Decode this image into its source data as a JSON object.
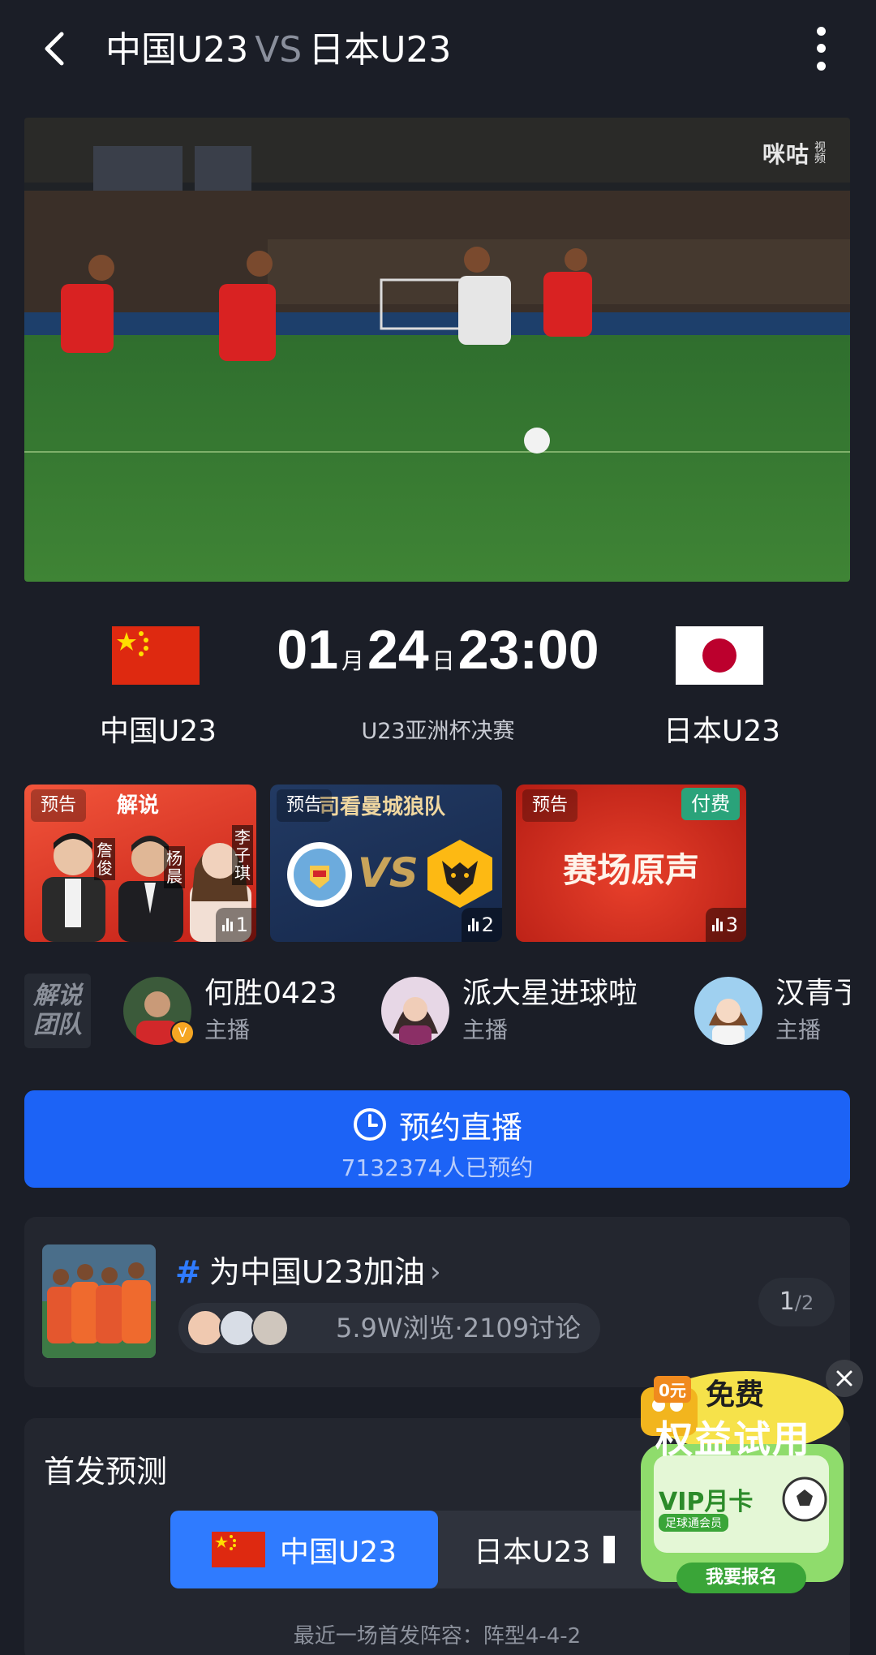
{
  "header": {
    "home_team": "中国U23",
    "vs": "VS",
    "away_team": "日本U23"
  },
  "video": {
    "watermark_brand": "咪咕",
    "watermark_suffix": "视频"
  },
  "match": {
    "month": "01",
    "month_unit": "月",
    "day": "24",
    "day_unit": "日",
    "time": "23:00",
    "home": "中国U23",
    "away": "日本U23",
    "stage": "U23亚洲杯决赛",
    "colors": {
      "china_red": "#de2910",
      "japan_red": "#bc002d",
      "star_yellow": "#ffde00"
    }
  },
  "streams": [
    {
      "tag": "预告",
      "title": "解说",
      "hosts": [
        "詹俊",
        "杨晨",
        "李子琪"
      ],
      "count": "1"
    },
    {
      "tag": "预告",
      "title": "司看曼城狼队",
      "vs": "VS",
      "count": "2"
    },
    {
      "tag": "预告",
      "paid": "付费",
      "title": "赛场原声",
      "count": "3"
    }
  ],
  "commentators": {
    "label_line1": "解说",
    "label_line2": "团队",
    "hosts": [
      {
        "name": "何胜0423",
        "role": "主播",
        "verified": "V"
      },
      {
        "name": "派大星进球啦",
        "role": "主播"
      },
      {
        "name": "汉青予",
        "role": "主播"
      }
    ]
  },
  "reserve": {
    "label": "预约直播",
    "count_text": "7132374人已预约",
    "icon": "clock-icon",
    "color": "#1c63f6"
  },
  "topic": {
    "hash": "#",
    "title": "为中国U23加油",
    "chevron": "›",
    "stats": "5.9W浏览·2109讨论",
    "page_current": "1",
    "page_total": "/2"
  },
  "lineup": {
    "title": "首发预测",
    "tabs": [
      "中国U23",
      "日本U23"
    ],
    "active_tab": 0,
    "note": "最近一场首发阵容：阵型4-4-2"
  },
  "promo": {
    "price": "0元",
    "free": "免费",
    "benefit": "权益试用",
    "vip": "VIP月卡",
    "vip_sub": "足球通会员",
    "cta": "我要报名"
  }
}
